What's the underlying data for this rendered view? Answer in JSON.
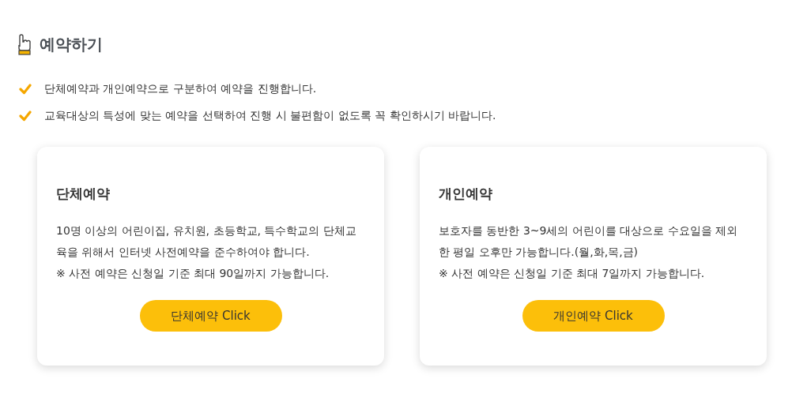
{
  "heading": "예약하기",
  "notes": [
    "단체예약과 개인예약으로 구분하여 예약을 진행합니다.",
    "교육대상의 특성에 맞는 예약을 선택하여 진행 시 불편함이 없도록 꼭 확인하시기 바랍니다."
  ],
  "cards": [
    {
      "title": "단체예약",
      "description": "10명 이상의 어린이집, 유치원, 초등학교, 특수학교의 단체교육을 위해서 인터넷 사전예약을 준수하여야 합니다.",
      "note": "※ 사전 예약은 신청일 기준 최대 90일까지 가능합니다.",
      "button": "단체예약 Click"
    },
    {
      "title": "개인예약",
      "description": "보호자를 동반한 3~9세의 어린이를 대상으로 수요일을 제외한 평일 오후만 가능합니다.(월,화,목,금)",
      "note": "※ 사전 예약은 신청일 기준 최대 7일까지 가능합니다.",
      "button": "개인예약 Click"
    }
  ]
}
